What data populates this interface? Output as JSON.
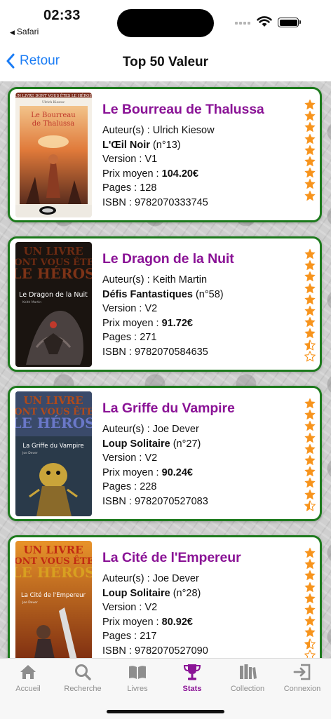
{
  "status_bar": {
    "time": "02:33",
    "back_app": "Safari"
  },
  "nav": {
    "back_label": "Retour",
    "title": "Top 50 Valeur"
  },
  "colors": {
    "accent": "#8a1396",
    "card_border": "#1c7a1c",
    "star": "#f7941d",
    "back_link": "#1a7cf5"
  },
  "books": [
    {
      "title": "Le Bourreau de Thalussa",
      "author_label": "Auteur(s) :",
      "author": "Ulrich Kiesow",
      "series": "L'Œil Noir",
      "number": "(n°13)",
      "version_label": "Version :",
      "version": "V1",
      "price_label": "Prix moyen :",
      "price": "104.20€",
      "pages_label": "Pages :",
      "pages": "128",
      "isbn_label": "ISBN :",
      "isbn": "9782070333745",
      "rating": 9,
      "max_rating": 9,
      "cover": {
        "top_text": "UN LIVRE DONT VOUS ÊTES LE HÉROS",
        "title": "Le Bourreau de Thalussa",
        "author": "Ulrich Kiesow",
        "style": "oeil-noir"
      }
    },
    {
      "title": "Le Dragon de la Nuit",
      "author_label": "Auteur(s) :",
      "author": "Keith Martin",
      "series": "Défis Fantastiques",
      "number": "(n°58)",
      "version_label": "Version :",
      "version": "V2",
      "price_label": "Prix moyen :",
      "price": "91.72€",
      "pages_label": "Pages :",
      "pages": "271",
      "isbn_label": "ISBN :",
      "isbn": "9782070584635",
      "rating": 8.5,
      "max_rating": 10,
      "cover": {
        "top_text": "UN LIVRE DONT VOUS ÊTES LE HÉROS",
        "title": "Le Dragon de la Nuit",
        "author": "Keith Martin",
        "style": "dragon"
      }
    },
    {
      "title": "La Griffe du Vampire",
      "author_label": "Auteur(s) :",
      "author": "Joe Dever",
      "series": "Loup Solitaire",
      "number": "(n°27)",
      "version_label": "Version :",
      "version": "V2",
      "price_label": "Prix moyen :",
      "price": "90.24€",
      "pages_label": "Pages :",
      "pages": "228",
      "isbn_label": "ISBN :",
      "isbn": "9782070527083",
      "rating": 9.5,
      "max_rating": 10,
      "cover": {
        "top_text": "UN LIVRE DONT VOUS ÊTES LE HÉROS",
        "title": "La Griffe du Vampire",
        "author": "Joe Dever",
        "style": "vampire"
      }
    },
    {
      "title": "La Cité de l'Empereur",
      "author_label": "Auteur(s) :",
      "author": "Joe Dever",
      "series": "Loup Solitaire",
      "number": "(n°28)",
      "version_label": "Version :",
      "version": "V2",
      "price_label": "Prix moyen :",
      "price": "80.92€",
      "pages_label": "Pages :",
      "pages": "217",
      "isbn_label": "ISBN :",
      "isbn": "9782070527090",
      "rating": 8.5,
      "max_rating": 10,
      "cover": {
        "top_text": "UN LIVRE DONT VOUS ÊTES LE HÉROS",
        "title": "La Cité de l'Empereur",
        "author": "Joe Dever",
        "style": "cite"
      }
    }
  ],
  "tabs": [
    {
      "label": "Accueil",
      "icon": "house-icon",
      "active": false
    },
    {
      "label": "Recherche",
      "icon": "magnifier-icon",
      "active": false
    },
    {
      "label": "Livres",
      "icon": "open-book-icon",
      "active": false
    },
    {
      "label": "Stats",
      "icon": "trophy-icon",
      "active": true
    },
    {
      "label": "Collection",
      "icon": "bookshelf-icon",
      "active": false
    },
    {
      "label": "Connexion",
      "icon": "login-icon",
      "active": false
    }
  ]
}
